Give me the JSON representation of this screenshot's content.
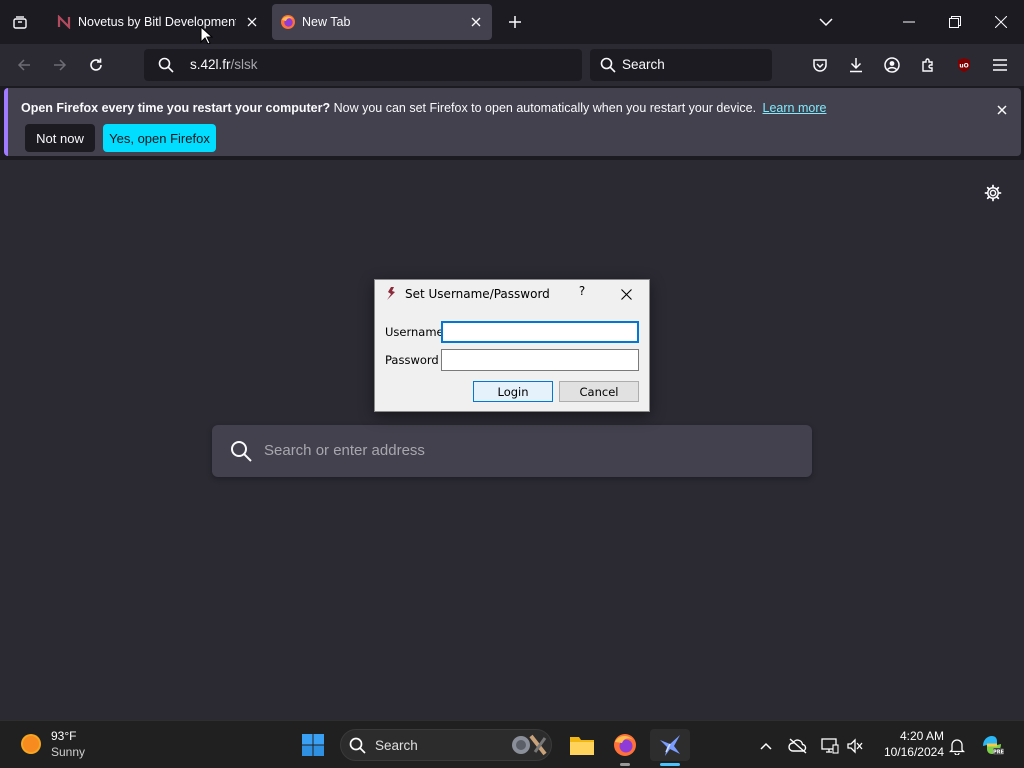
{
  "tabs": [
    {
      "title": "Novetus by Bitl Development Studio",
      "active": false
    },
    {
      "title": "New Tab",
      "active": true
    }
  ],
  "address_bar": {
    "url_prefix": "s.42l.fr",
    "url_path": "/slsk"
  },
  "search_bar": {
    "placeholder": "Search"
  },
  "notification": {
    "bold_text": "Open Firefox every time you restart your computer?",
    "text": "Now you can set Firefox to open automatically when you restart your device.",
    "link": "Learn more",
    "secondary_button": "Not now",
    "primary_button": "Yes, open Firefox"
  },
  "newtab": {
    "search_placeholder": "Search or enter address"
  },
  "dialog": {
    "title": "Set Username/Password",
    "help": "?",
    "username_label": "Username",
    "username_value": "",
    "password_label": "Password",
    "password_value": "",
    "login_button": "Login",
    "cancel_button": "Cancel"
  },
  "taskbar": {
    "weather_temp": "93°F",
    "weather_desc": "Sunny",
    "search_label": "Search",
    "time": "4:20 AM",
    "date": "10/16/2024"
  },
  "colors": {
    "accent_cyan": "#00ddff",
    "link_cyan": "#80ebff",
    "notice_stripe": "#a07aff",
    "dialog_focus": "#0078d4"
  },
  "icons": [
    "tab-list-icon",
    "novetus-favicon-icon",
    "firefox-favicon-icon",
    "close-icon",
    "plus-icon",
    "chevron-down-icon",
    "minimize-icon",
    "restore-icon",
    "back-icon",
    "forward-icon",
    "reload-icon",
    "search-icon",
    "pocket-icon",
    "download-icon",
    "account-icon",
    "extensions-icon",
    "ublock-icon",
    "menu-icon",
    "gear-icon",
    "windows-start-icon",
    "file-explorer-icon",
    "firefox-icon",
    "novetus-icon",
    "weather-sun-icon",
    "chevron-up-icon",
    "cloud-offline-icon",
    "display-icon",
    "speaker-muted-icon",
    "bell-icon",
    "copilot-icon"
  ]
}
